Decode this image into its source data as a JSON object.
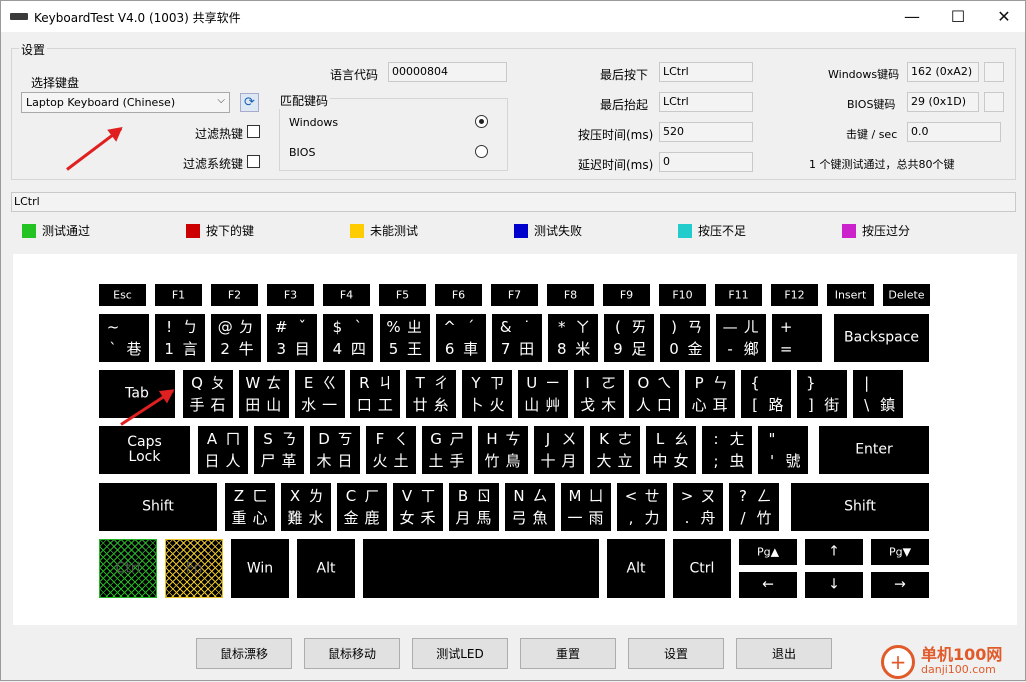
{
  "title": "KeyboardTest V4.0 (1003) 共享软件",
  "window_controls": {
    "minimize": "—",
    "maximize": "☐",
    "close": "✕"
  },
  "settings": {
    "group_label": "设置",
    "select_keyboard_label": "选择键盘",
    "keyboard_value": "Laptop Keyboard (Chinese)",
    "filter_hotkeys": "过滤热键",
    "filter_system_keys": "过滤系统键",
    "lang_code_label": "语言代码",
    "lang_code_value": "00000804",
    "match_keycode_label": "匹配键码",
    "match_options": [
      "Windows",
      "BIOS"
    ],
    "match_selected": "Windows",
    "last_down_label": "最后按下",
    "last_down_value": "LCtrl",
    "last_up_label": "最后抬起",
    "last_up_value": "LCtrl",
    "press_time_label": "按压时间(ms)",
    "press_time_value": "520",
    "delay_time_label": "延迟时间(ms)",
    "delay_time_value": "0",
    "windows_code_label": "Windows键码",
    "windows_code_value": "162 (0xA2)",
    "bios_code_label": "BIOS键码",
    "bios_code_value": "29 (0x1D)",
    "hits_label": "击键 / sec",
    "hits_value": "0.0",
    "summary": "1 个键测试通过，总共80个键"
  },
  "last_key_bar": "LCtrl",
  "legend": [
    {
      "label": "测试通过",
      "color": "#22c322"
    },
    {
      "label": "按下的键",
      "color": "#cc0000"
    },
    {
      "label": "未能测试",
      "color": "#ffcc00"
    },
    {
      "label": "测试失败",
      "color": "#0000cc"
    },
    {
      "label": "按压不足",
      "color": "#22cccc"
    },
    {
      "label": "按压过分",
      "color": "#cc22cc"
    }
  ],
  "keys": {
    "fn_row": [
      "Esc",
      "F1",
      "F2",
      "F3",
      "F4",
      "F5",
      "F6",
      "F7",
      "F8",
      "F9",
      "F10",
      "F11",
      "F12",
      "Insert",
      "Delete"
    ],
    "num_row": [
      [
        "~",
        "",
        "`",
        "巷"
      ],
      [
        "!",
        "ㄅ",
        "1",
        "言"
      ],
      [
        "@",
        "ㄉ",
        "2",
        "牛"
      ],
      [
        "#",
        "ˇ",
        "3",
        "目"
      ],
      [
        "$",
        "ˋ",
        "4",
        "四"
      ],
      [
        "%",
        "ㄓ",
        "5",
        "王"
      ],
      [
        "^",
        "ˊ",
        "6",
        "車"
      ],
      [
        "&",
        "˙",
        "7",
        "田"
      ],
      [
        "*",
        "ㄚ",
        "8",
        "米"
      ],
      [
        "(",
        "ㄞ",
        "9",
        "足"
      ],
      [
        ")",
        "ㄢ",
        "0",
        "金"
      ],
      [
        "—",
        "ㄦ",
        "-",
        "鄉"
      ],
      [
        "+",
        "",
        "=",
        ""
      ]
    ],
    "backspace": "Backspace",
    "tab": "Tab",
    "q_row": [
      [
        "Q",
        "ㄆ",
        "手",
        "石"
      ],
      [
        "W",
        "ㄊ",
        "田",
        "山"
      ],
      [
        "E",
        "ㄍ",
        "水",
        "一"
      ],
      [
        "R",
        "ㄐ",
        "口",
        "工"
      ],
      [
        "T",
        "ㄔ",
        "廿",
        "糸"
      ],
      [
        "Y",
        "ㄗ",
        "卜",
        "火"
      ],
      [
        "U",
        "ㄧ",
        "山",
        "艸"
      ],
      [
        "I",
        "ㄛ",
        "戈",
        "木"
      ],
      [
        "O",
        "ㄟ",
        "人",
        "口"
      ],
      [
        "P",
        "ㄣ",
        "心",
        "耳"
      ],
      [
        "{",
        "",
        "[",
        "路"
      ],
      [
        "}",
        "",
        "]",
        "街"
      ],
      [
        "|",
        "",
        "\\",
        "鎮"
      ]
    ],
    "caps": "Caps\nLock",
    "a_row": [
      [
        "A",
        "ㄇ",
        "日",
        "人"
      ],
      [
        "S",
        "ㄋ",
        "尸",
        "革"
      ],
      [
        "D",
        "ㄎ",
        "木",
        "日"
      ],
      [
        "F",
        "ㄑ",
        "火",
        "土"
      ],
      [
        "G",
        "ㄕ",
        "土",
        "手"
      ],
      [
        "H",
        "ㄘ",
        "竹",
        "鳥"
      ],
      [
        "J",
        "ㄨ",
        "十",
        "月"
      ],
      [
        "K",
        "ㄜ",
        "大",
        "立"
      ],
      [
        "L",
        "ㄠ",
        "中",
        "女"
      ],
      [
        ":",
        "ㄤ",
        ";",
        "虫"
      ],
      [
        "\"",
        "",
        "'",
        "號"
      ]
    ],
    "enter": "Enter",
    "shift_l": "Shift",
    "z_row": [
      [
        "Z",
        "ㄈ",
        "重",
        "心"
      ],
      [
        "X",
        "ㄌ",
        "難",
        "水"
      ],
      [
        "C",
        "ㄏ",
        "金",
        "鹿"
      ],
      [
        "V",
        "ㄒ",
        "女",
        "禾"
      ],
      [
        "B",
        "ㄖ",
        "月",
        "馬"
      ],
      [
        "N",
        "ㄙ",
        "弓",
        "魚"
      ],
      [
        "M",
        "ㄩ",
        "一",
        "雨"
      ],
      [
        "<",
        "ㄝ",
        ",",
        "力"
      ],
      [
        ">",
        "ㄡ",
        ".",
        "舟"
      ],
      [
        "?",
        "ㄥ",
        "/",
        "竹"
      ]
    ],
    "shift_r": "Shift",
    "bottom": {
      "ctrl_l": "Ctrl",
      "fn": "Fn",
      "win": "Win",
      "alt_l": "Alt",
      "space": "",
      "alt_r": "Alt",
      "ctrl_r": "Ctrl"
    },
    "nav": {
      "pgup": "Pg▲",
      "up": "↑",
      "pgdn": "Pg▼",
      "left": "←",
      "down": "↓",
      "right": "→"
    }
  },
  "buttons": [
    "鼠标漂移",
    "鼠标移动",
    "测试LED",
    "重置",
    "设置",
    "退出"
  ],
  "watermark": {
    "line1": "单机100网",
    "line2": "danji100.com"
  }
}
